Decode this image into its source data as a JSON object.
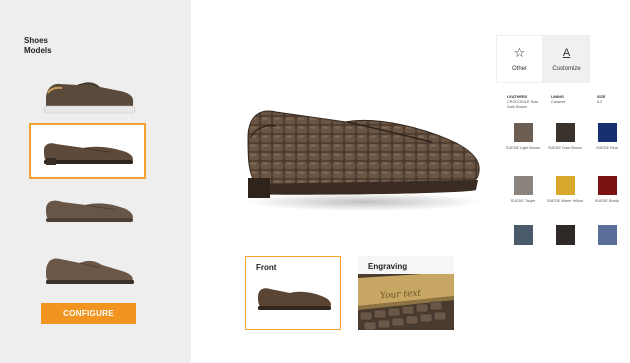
{
  "sidebar": {
    "title_line1": "Shoes",
    "title_line2": "Models",
    "models": [
      {
        "name": "model-sneaker",
        "selected": false
      },
      {
        "name": "model-loafer",
        "selected": true
      },
      {
        "name": "model-driver",
        "selected": false
      },
      {
        "name": "model-oxford",
        "selected": false
      }
    ],
    "configure_label": "CONFIGURE"
  },
  "colors": {
    "accent": "#f29420",
    "selection_border": "#f7a12f",
    "sidebar_bg": "#eeeeee",
    "shoe_brown": "#5a4636"
  },
  "views": {
    "front_label": "Front",
    "engraving_label": "Engraving",
    "engraving_text": "Your text"
  },
  "mode_tabs": {
    "other_label": "Other",
    "other_icon": "star-icon",
    "customize_label": "Customize",
    "customize_icon": "letter-a-icon"
  },
  "specs": {
    "leather_header": "LEATHERS",
    "leather_value": "CROCODILE Sole Dark Brown",
    "lining_header": "LINING",
    "lining_value": "Caramel",
    "size_header": "SIZE",
    "size_value": "6.2"
  },
  "swatches": [
    {
      "label": "SUEDE Light Brown",
      "color": "#6d5e54"
    },
    {
      "label": "SUEDE Dark Brown",
      "color": "#3a322d"
    },
    {
      "label": "SUEDE Blue",
      "color": "#17306f"
    },
    {
      "label": "SUEDE Taupe",
      "color": "#8b837d"
    },
    {
      "label": "SUEDE Warm Yellow",
      "color": "#d8a82c"
    },
    {
      "label": "SUEDE Bordo",
      "color": "#7a1414"
    },
    {
      "label": "",
      "color": "#4a5a6a"
    },
    {
      "label": "",
      "color": "#2f2a28"
    },
    {
      "label": "",
      "color": "#5a6e9a"
    }
  ]
}
